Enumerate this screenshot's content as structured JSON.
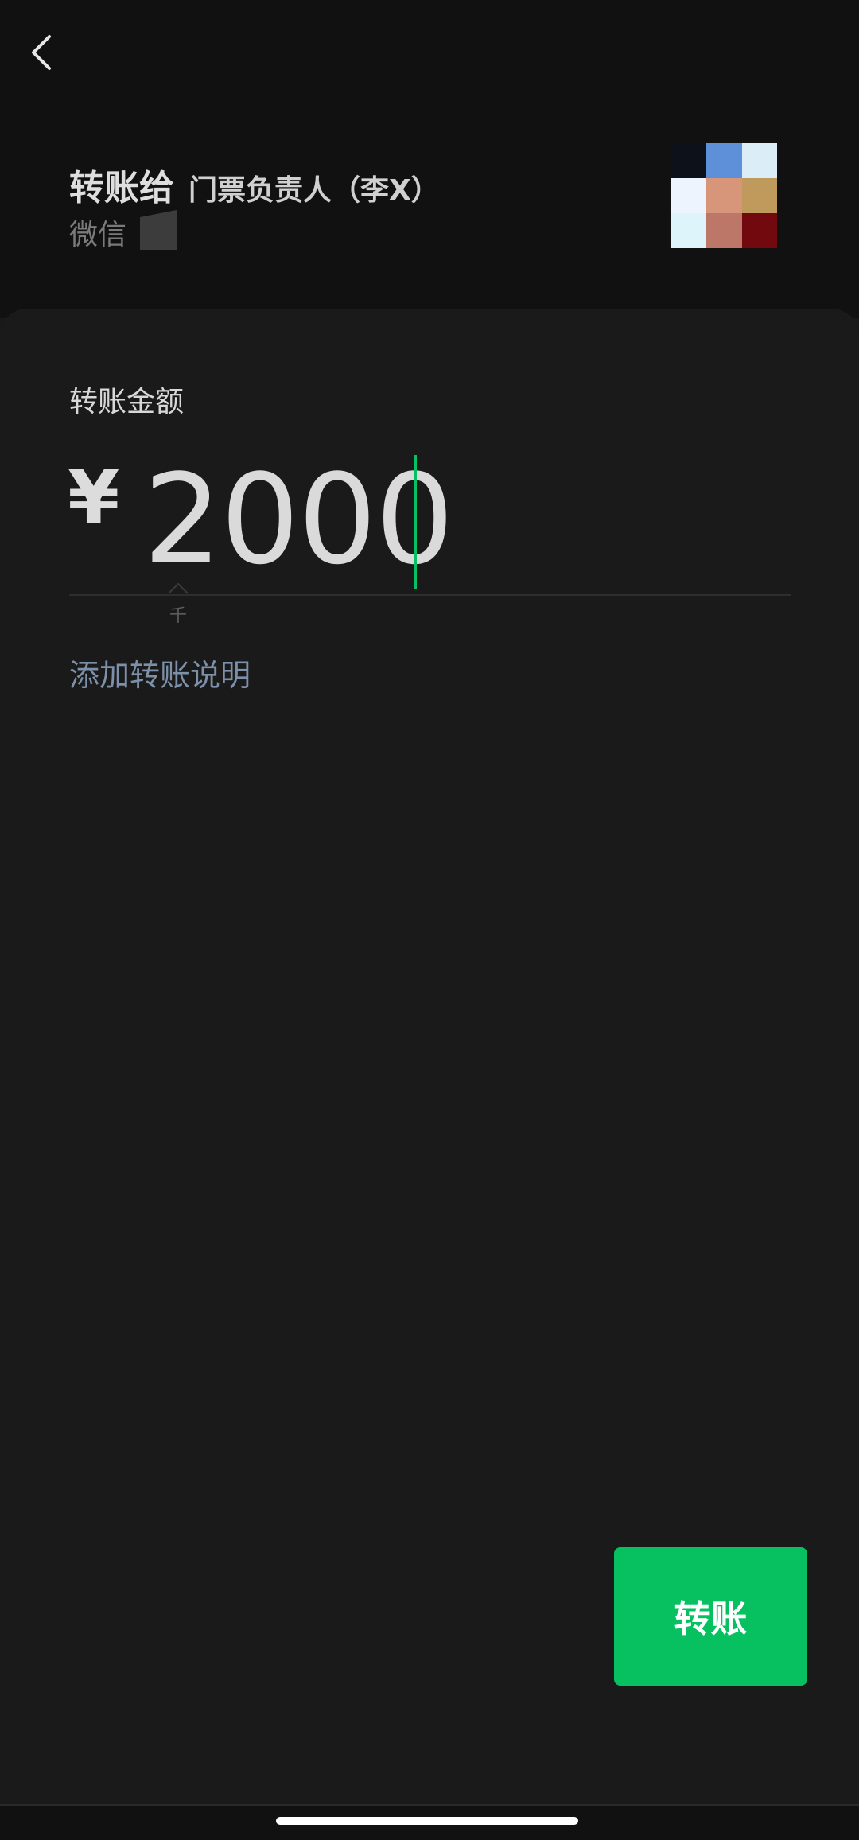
{
  "header": {
    "back_icon": "chevron-left-icon",
    "transfer_to_label": "转账给",
    "recipient_name": "门票负责人（李X）",
    "wechat_label": "微信",
    "avatar_colors": [
      "#0d111a",
      "#5e8fd9",
      "#dbeef8",
      "#edf4fd",
      "#d7957a",
      "#c09a5c",
      "#def4fb",
      "#bc7768",
      "#72090f"
    ]
  },
  "form": {
    "amount_label": "转账金额",
    "currency_symbol": "¥",
    "amount_value": "2000",
    "unit_hint": "千",
    "add_note_label": "添加转账说明"
  },
  "actions": {
    "transfer_button_label": "转账"
  },
  "colors": {
    "accent": "#07c160",
    "link": "#7d90a9",
    "background": "#191919"
  }
}
